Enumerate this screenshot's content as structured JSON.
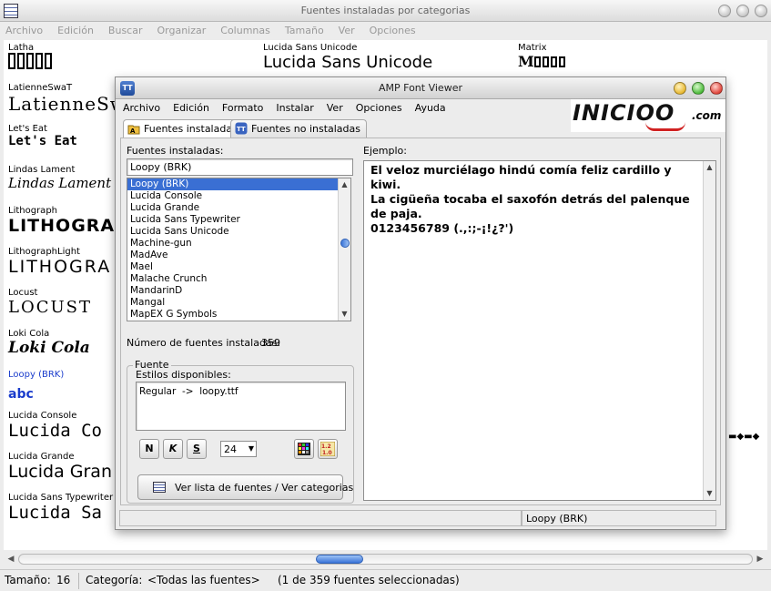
{
  "main_window": {
    "title": "Fuentes instaladas por categorias",
    "menu": [
      "Archivo",
      "Edición",
      "Buscar",
      "Organizar",
      "Columnas",
      "Tamaño",
      "Ver",
      "Opciones"
    ],
    "fonts": [
      {
        "name": "Latha",
        "sample": ""
      },
      {
        "name": "LatienneSwaT",
        "sample": "LatienneSwa"
      },
      {
        "name": "Let's Eat",
        "sample": "Let's Eat"
      },
      {
        "name": "Lindas Lament",
        "sample": "Lindas Lament"
      },
      {
        "name": "Lithograph",
        "sample": "LITHOGRA"
      },
      {
        "name": "LithographLight",
        "sample": "LITHOGRA"
      },
      {
        "name": "Locust",
        "sample": "LOCUST"
      },
      {
        "name": "Loki Cola",
        "sample": "Loki Cola"
      },
      {
        "name": "Loopy (BRK)",
        "sample": "abc"
      },
      {
        "name": "Lucida Console",
        "sample": "Lucida Co"
      },
      {
        "name": "Lucida Grande",
        "sample": "Lucida Gran"
      },
      {
        "name": "Lucida Sans Typewriter",
        "sample": "Lucida Sa"
      },
      {
        "name": "Lucida Sans Unicode",
        "sample": "Lucida Sans Unicode"
      },
      {
        "name": "Matrix",
        "sample": "M"
      }
    ]
  },
  "status": {
    "size_label": "Tamaño:",
    "size_value": "16",
    "category_label": "Categoría:",
    "category_value": "<Todas las fuentes>",
    "category_note": "(1 de 359 fuentes seleccionadas)"
  },
  "dialog": {
    "title": "AMP Font Viewer",
    "menu": [
      "Archivo",
      "Edición",
      "Formato",
      "Instalar",
      "Ver",
      "Opciones",
      "Ayuda"
    ],
    "logo_text": "INICIOO",
    "logo_suffix": ".com",
    "tabs": [
      "Fuentes instaladas",
      "Fuentes no instaladas"
    ],
    "installed_label": "Fuentes instaladas:",
    "search_value": "Loopy (BRK)",
    "font_list": [
      "Loopy (BRK)",
      "Lucida Console",
      "Lucida Grande",
      "Lucida Sans Typewriter",
      "Lucida Sans Unicode",
      "Machine-gun",
      "MadAve",
      "Mael",
      "Malache Crunch",
      "MandarinD",
      "Mangal",
      "MapEX G Symbols"
    ],
    "selected_index": 0,
    "count_label": "Número de fuentes instaladas:",
    "count_value": "359",
    "group_label": "Fuente",
    "styles_label": "Estilos disponibles:",
    "styles_value": "Regular  ->  loopy.ttf",
    "bold_label": "N",
    "italic_label": "K",
    "underline_label": "S",
    "size_value": "24",
    "list_button": "Ver lista de fuentes / Ver categorias",
    "sample_label": "Ejemplo:",
    "sample_text": "El veloz murciélago hindú comía feliz cardillo y kiwi.\nLa cigüeña tocaba el saxofón detrás del palenque de paja.\n0123456789 (.,:;-¡!¿?')",
    "status_font": "Loopy (BRK)"
  },
  "colors": {
    "selection": "#3a6fd3",
    "link_selected": "#1a3ccc",
    "close_red": "#e0443a",
    "minimize_yellow": "#e8b830",
    "zoom_green": "#4cbb3a"
  }
}
